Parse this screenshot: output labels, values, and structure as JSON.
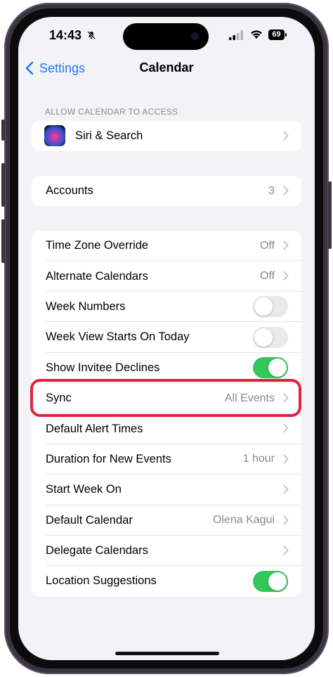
{
  "status_bar": {
    "time": "14:43",
    "battery": "69"
  },
  "nav": {
    "back_label": "Settings",
    "title": "Calendar"
  },
  "section_access": {
    "header": "ALLOW CALENDAR TO ACCESS",
    "items": [
      {
        "label": "Siri & Search"
      }
    ]
  },
  "accounts": {
    "label": "Accounts",
    "value": "3"
  },
  "settings": {
    "items": [
      {
        "label": "Time Zone Override",
        "value": "Off",
        "kind": "chevron"
      },
      {
        "label": "Alternate Calendars",
        "value": "Off",
        "kind": "chevron"
      },
      {
        "label": "Week Numbers",
        "kind": "toggle",
        "on": false
      },
      {
        "label": "Week View Starts On Today",
        "kind": "toggle",
        "on": false
      },
      {
        "label": "Show Invitee Declines",
        "kind": "toggle",
        "on": true
      },
      {
        "label": "Sync",
        "value": "All Events",
        "kind": "chevron",
        "highlighted": true
      },
      {
        "label": "Default Alert Times",
        "value": "",
        "kind": "chevron"
      },
      {
        "label": "Duration for New Events",
        "value": "1 hour",
        "kind": "chevron"
      },
      {
        "label": "Start Week On",
        "value": "",
        "kind": "chevron"
      },
      {
        "label": "Default Calendar",
        "value": "Olena Kagui",
        "kind": "chevron"
      },
      {
        "label": "Delegate Calendars",
        "value": "",
        "kind": "chevron"
      },
      {
        "label": "Location Suggestions",
        "kind": "toggle",
        "on": true
      }
    ]
  },
  "colors": {
    "accent": "#1a7cf5",
    "toggle_on": "#34c759",
    "highlight": "#e0223f",
    "background": "#f2f2f7"
  },
  "icons": [
    "chevron-left-icon",
    "bell-slash-icon",
    "signal-icon",
    "wifi-icon",
    "battery-icon",
    "siri-icon",
    "chevron-right-icon"
  ]
}
